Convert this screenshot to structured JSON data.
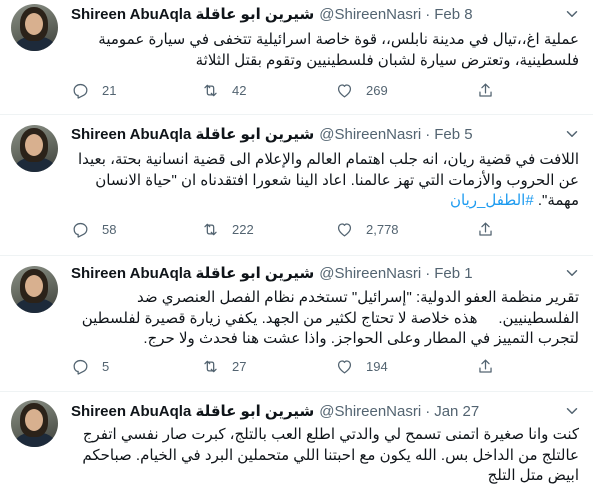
{
  "tweets": [
    {
      "name": "Shireen AbuAqla شيرين ابو عاقلة",
      "handle": "@ShireenNasri",
      "date": "Feb 8",
      "text": "عملية اغ،،تيال في مدينة نابلس،، قوة خاصة اسرائيلية تتخفى في سيارة عمومية فلسطينية، وتعترض سيارة لشبان فلسطينيين وتقوم بقتل الثلاثة",
      "hashtag": "",
      "replies": "21",
      "retweets": "42",
      "likes": "269"
    },
    {
      "name": "Shireen AbuAqla شيرين ابو عاقلة",
      "handle": "@ShireenNasri",
      "date": "Feb 5",
      "text": "اللافت في قضية ريان، انه جلب اهتمام العالم والإعلام الى قضية انسانية بحتة، بعيدا عن الحروب والأزمات التي تهز عالمنا. اعاد الينا شعورا افتقدناه ان \"حياة الانسان مهمة\". ",
      "hashtag": "#الطفل_ريان",
      "replies": "58",
      "retweets": "222",
      "likes": "2,778"
    },
    {
      "name": "Shireen AbuAqla شيرين ابو عاقلة",
      "handle": "@ShireenNasri",
      "date": "Feb 1",
      "text": "تقرير منظمة العفو الدولية: \"إسرائيل\" تستخدم نظام الفصل العنصري ضد الفلسطينيين.     هذه خلاصة لا تحتاج لكثير من الجهد. يكفي زيارة قصيرة لفلسطين لتجرب التمييز في المطار وعلى الحواجز. واذا عشت هنا فحدث ولا حرج.",
      "hashtag": "",
      "replies": "5",
      "retweets": "27",
      "likes": "194"
    },
    {
      "name": "Shireen AbuAqla شيرين ابو عاقلة",
      "handle": "@ShireenNasri",
      "date": "Jan 27",
      "text": "كنت وانا صغيرة اتمنى تسمح لي والدتي اطلع العب بالتلج، كبرت صار نفسي اتفرج عالتلج من الداخل بس. الله يكون مع احبتنا اللي متحملين البرد في الخيام. صباحكم ابيض متل التلج",
      "hashtag": "",
      "replies": "",
      "retweets": "",
      "likes": ""
    }
  ]
}
